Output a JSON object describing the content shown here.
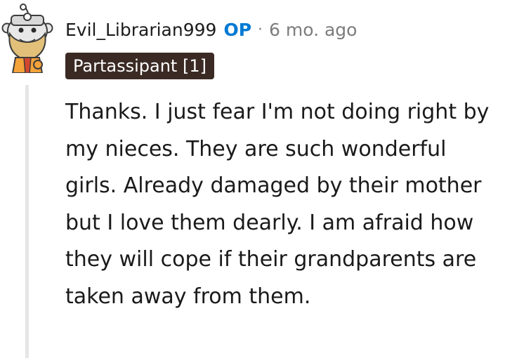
{
  "comment": {
    "author": "Evil_Librarian999",
    "op_badge": "OP",
    "separator": "·",
    "timestamp": "6 mo. ago",
    "flair": "Partassipant [1]",
    "body": "Thanks. I just fear I'm not doing right by my nieces. They are such wonderful girls. Already damaged by their mother but I love them dearly. I am afraid how they will cope if their grandparents are taken away from them.",
    "avatar_icon": "snoo-wizard-avatar-icon"
  },
  "colors": {
    "op": "#0079d3",
    "meta": "#7c7c7c",
    "flair_bg": "#3b2a24",
    "flair_text": "#ffffff",
    "thread_line": "#e6e6e6",
    "text": "#1a1a1b"
  }
}
